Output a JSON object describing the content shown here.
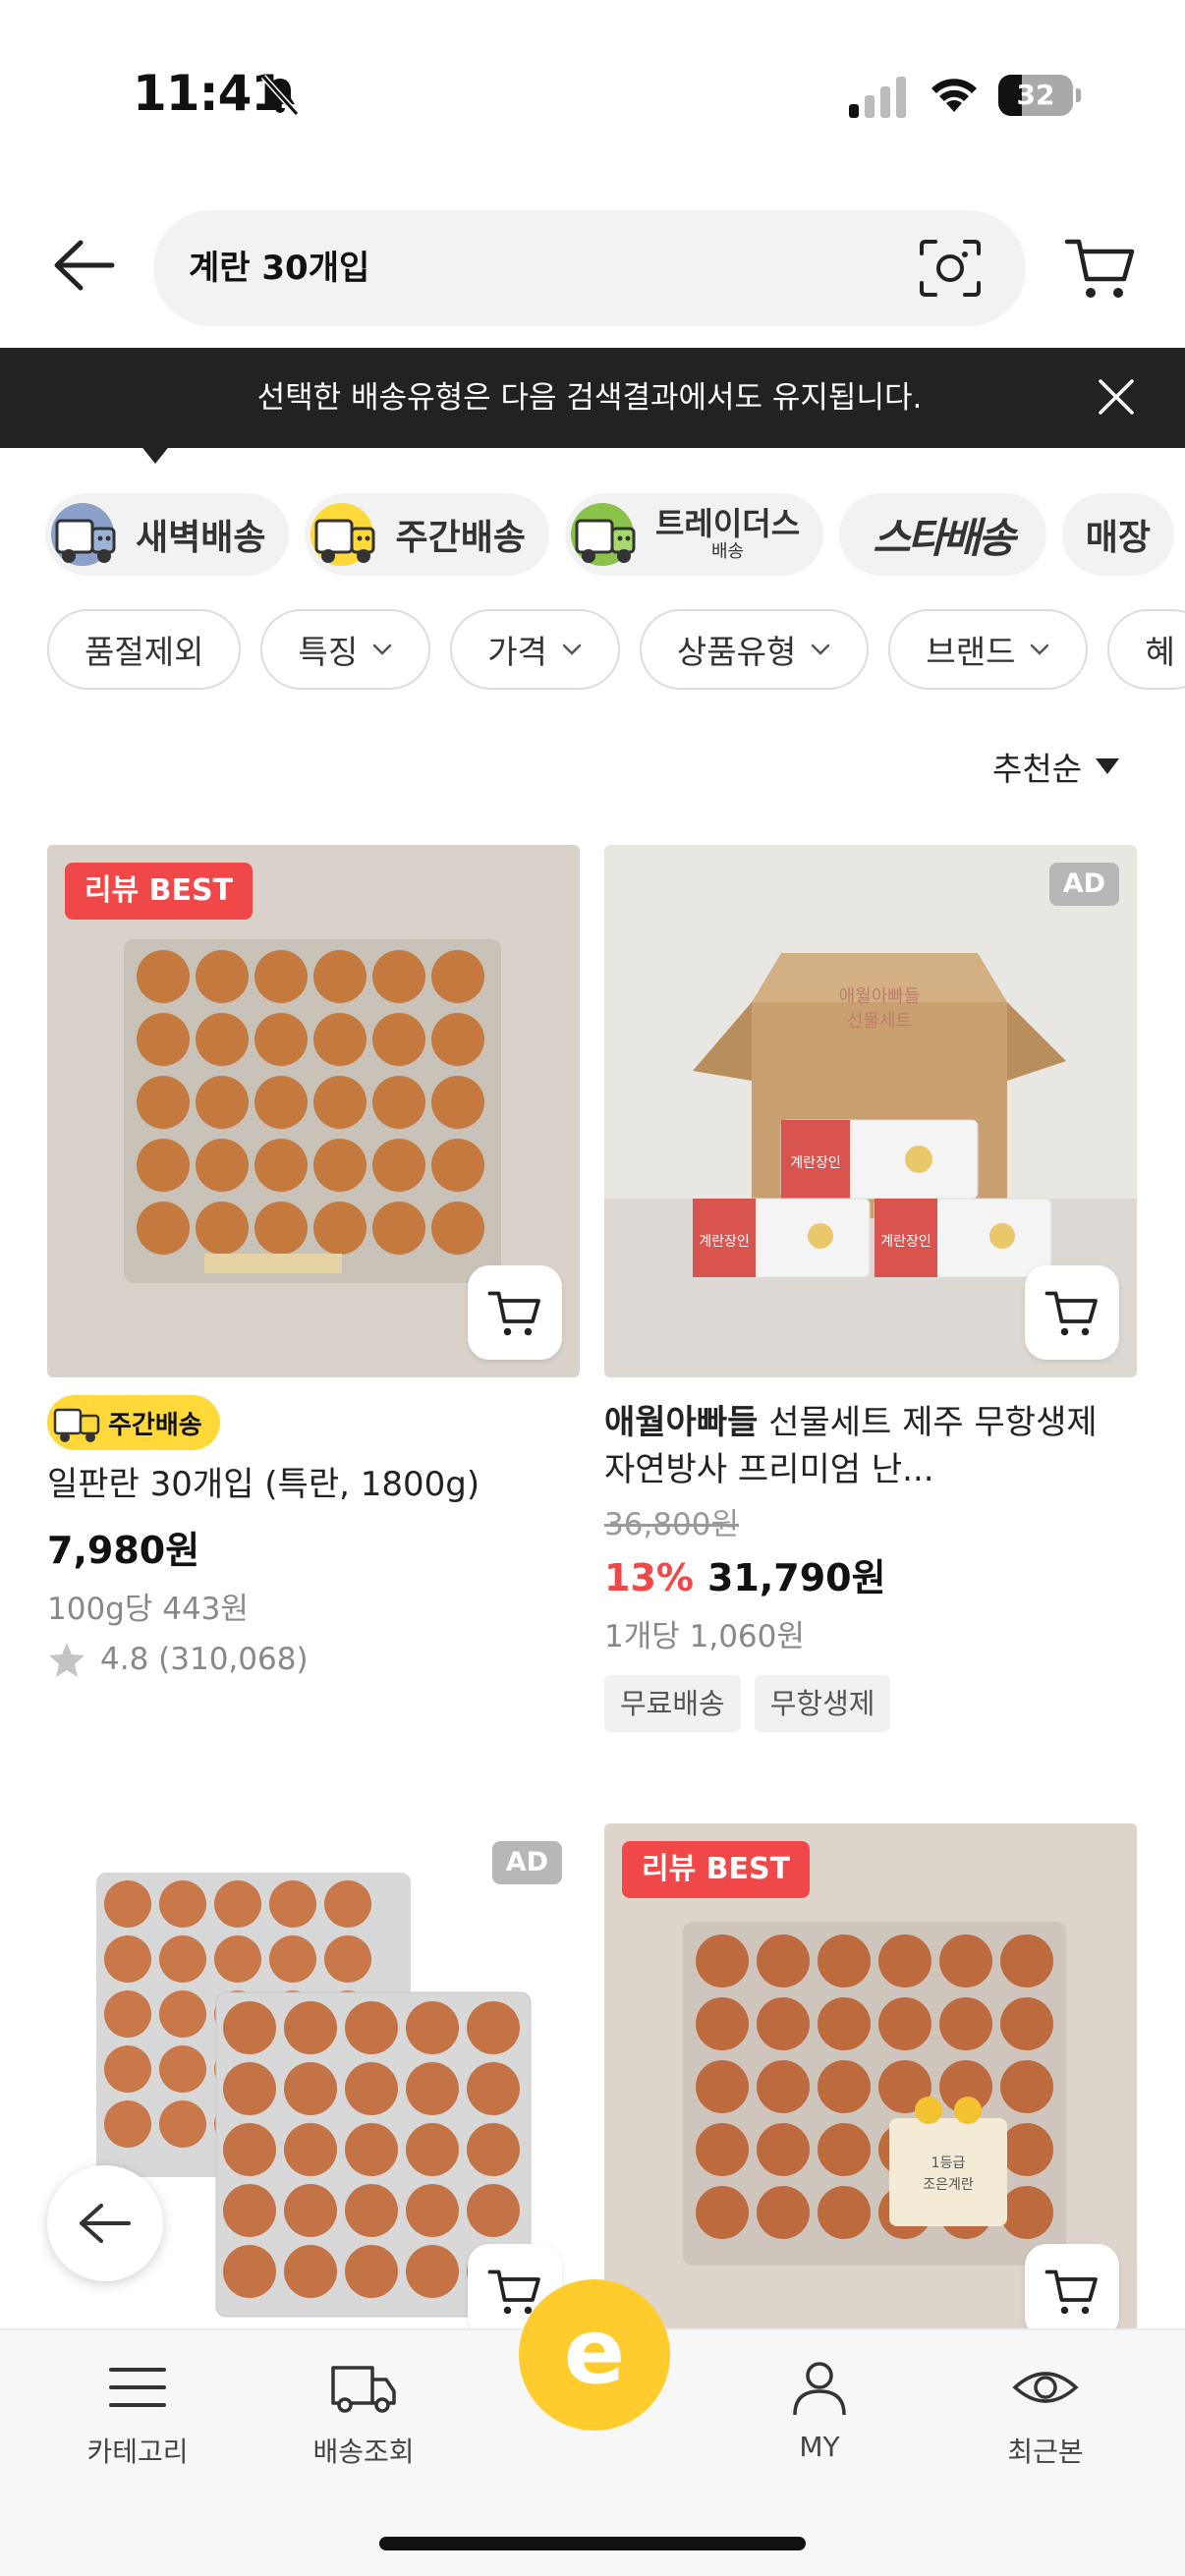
{
  "status_bar": {
    "time": "11:41",
    "battery": "32",
    "battery_level": 0.32
  },
  "header": {
    "search_value": "계란 30개입"
  },
  "banner": {
    "text": "선택한 배송유형은 다음 검색결과에서도 유지됩니다."
  },
  "delivery_types": [
    {
      "label": "새벽배송",
      "color": "#8aa0c8"
    },
    {
      "label": "주간배송",
      "color": "#ffd83a"
    },
    {
      "label": "트레이더스",
      "sub": "배송",
      "color": "#8bc34a"
    },
    {
      "label": "스타배송"
    },
    {
      "label": "매장"
    }
  ],
  "filters": [
    {
      "label": "품절제외"
    },
    {
      "label": "특징"
    },
    {
      "label": "가격"
    },
    {
      "label": "상품유형"
    },
    {
      "label": "브랜드"
    },
    {
      "label": "혜"
    }
  ],
  "sort": {
    "label": "추천순"
  },
  "products": [
    {
      "badge": "리뷰 BEST",
      "delivery_tag": "주간배송",
      "title": "일판란 30개입 (특란, 1800g)",
      "price": "7,980원",
      "unit_price": "100g당 443원",
      "rating": "4.8 (310,068)"
    },
    {
      "badge": "AD",
      "brand": "애월아빠들",
      "title": " 선물세트 제주 무항생제 자연방사 프리미엄 난...",
      "original_price": "36,800원",
      "discount": "13%",
      "price": "31,790원",
      "unit_price": "1개당 1,060원",
      "chips": [
        "무료배송",
        "무항생제"
      ],
      "product_labels": [
        "애월아빠들",
        "선물세트",
        "계란장인"
      ]
    },
    {
      "badge": "AD"
    },
    {
      "badge": "리뷰 BEST",
      "product_labels": [
        "1등급",
        "조은계란"
      ]
    }
  ],
  "bottom_nav": [
    {
      "label": "카테고리"
    },
    {
      "label": "배송조회"
    },
    {
      "label": "MY"
    },
    {
      "label": "최근본"
    }
  ],
  "home_button": "e",
  "colors": {
    "accent_yellow": "#ffcc2e",
    "sale_red": "#f04848",
    "banner_bg": "#222222"
  }
}
